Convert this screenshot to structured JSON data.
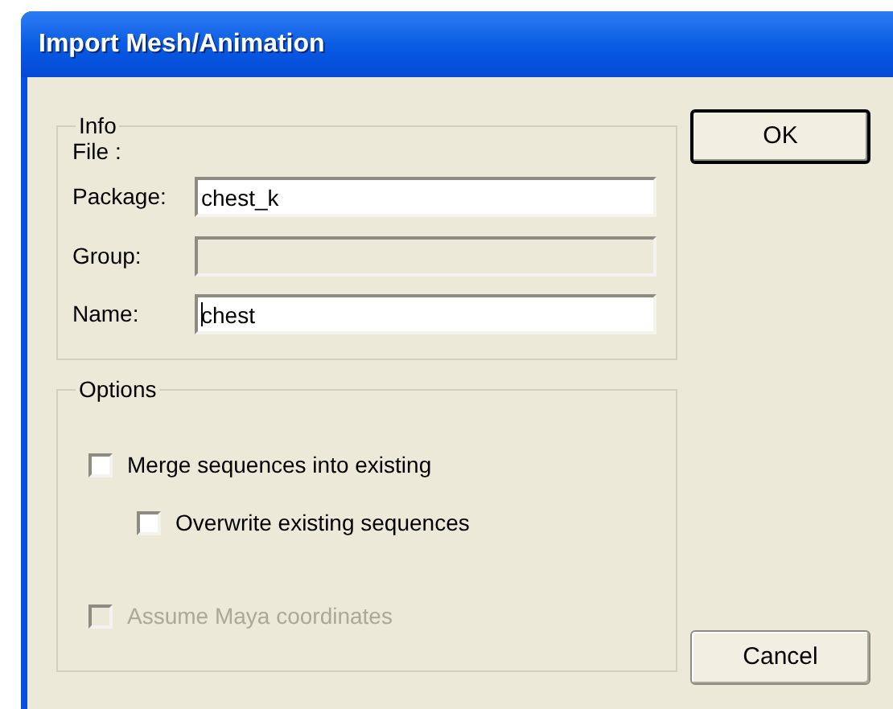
{
  "window": {
    "title": "Import Mesh/Animation"
  },
  "info": {
    "legend": "Info",
    "file_label": "File :",
    "fields": [
      {
        "label": "Package:",
        "value": "chest_k",
        "disabled": false,
        "focused": false
      },
      {
        "label": "Group:",
        "disabled": true,
        "focused": false
      },
      {
        "label": "Name:",
        "value": "chest",
        "disabled": false,
        "focused": true
      }
    ]
  },
  "options": {
    "legend": "Options",
    "checkboxes": [
      {
        "label": "Merge sequences into existing",
        "checked": false,
        "disabled": false,
        "children": [
          {
            "label": "Overwrite existing sequences",
            "checked": false,
            "disabled": false
          }
        ]
      },
      {
        "label": "Assume Maya coordinates",
        "checked": false,
        "disabled": true
      }
    ]
  },
  "buttons": [
    {
      "label": "OK",
      "kind": "default"
    },
    {
      "label": "Cancel",
      "kind": "normal"
    }
  ]
}
